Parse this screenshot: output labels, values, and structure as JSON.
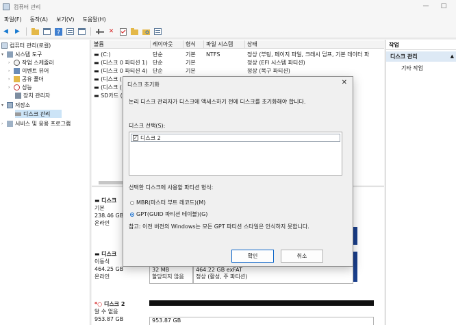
{
  "window": {
    "title": "컴퓨터 관리",
    "minimize_glyph": "—",
    "maximize_glyph": "□"
  },
  "menu": [
    "파일(F)",
    "동작(A)",
    "보기(V)",
    "도움말(H)"
  ],
  "tree": {
    "root": "컴퓨터 관리(로컬)",
    "system_tools": "시스템 도구",
    "task_scheduler": "작업 스케줄러",
    "event_viewer": "이벤트 뷰어",
    "shared_folders": "공유 폴더",
    "performance": "성능",
    "device_manager": "장치 관리자",
    "storage": "저장소",
    "disk_management": "디스크 관리",
    "services": "서비스 및 응용 프로그램"
  },
  "volume_table": {
    "columns": [
      "볼륨",
      "레이아웃",
      "형식",
      "파일 시스템",
      "상태"
    ],
    "rows": [
      [
        "(C:)",
        "단순",
        "기본",
        "NTFS",
        "정상 (부팅, 페이지 파일, 크래시 덤프, 기본 데이터 파"
      ],
      [
        "(디스크 0 파티션 1)",
        "단순",
        "기본",
        "",
        "정상 (EFI 시스템 파티션)"
      ],
      [
        "(디스크 0 파티션 4)",
        "단순",
        "기본",
        "",
        "정상 (복구 파티션)"
      ],
      [
        "(디스크 (",
        "",
        "",
        "",
        ""
      ],
      [
        "(디스크 (",
        "",
        "",
        "",
        ""
      ],
      [
        "SD카드 (",
        "",
        "",
        "",
        ""
      ]
    ]
  },
  "disks": [
    {
      "name": "디스크",
      "type": "기본",
      "size": "238.46 GB",
      "status": "온라인"
    },
    {
      "name": "디스크",
      "type": "이동식",
      "size": "464.25 GB",
      "status": "온라인",
      "partitions": [
        {
          "size": "32 MB",
          "status": "할당되지 않음"
        },
        {
          "size": "464.22 GB exFAT",
          "status": "정상 (활성, 주 파티션)"
        }
      ]
    },
    {
      "name": "디스크 2",
      "type": "알 수 없음",
      "size": "953.87 GB",
      "partition_size": "953.87 GB"
    }
  ],
  "actions": {
    "title": "작업",
    "section": "디스크 관리",
    "item": "기타 작업"
  },
  "dialog": {
    "title": "디스크 초기화",
    "close_glyph": "✕",
    "description": "논리 디스크 관리자가 디스크에 액세스하기 전에 디스크를 초기화해야 합니다.",
    "select_label": "디스크 선택(S):",
    "disk_item": "디스크 2",
    "partition_label": "선택한 디스크에 사용할 파티션 형식:",
    "option_mbr": "MBR(마스터 부트 레코드)(M)",
    "option_gpt": "GPT(GUID 파티션 테이블)(G)",
    "note": "참고: 이전 버전의 Windows는 모든 GPT 파티션 스타일은 인식하지 못합니다.",
    "ok": "확인",
    "cancel": "취소"
  },
  "colors": {
    "selection": "#cce4f7",
    "accent": "#0a64c8",
    "unallocated_bar": "#101010"
  }
}
